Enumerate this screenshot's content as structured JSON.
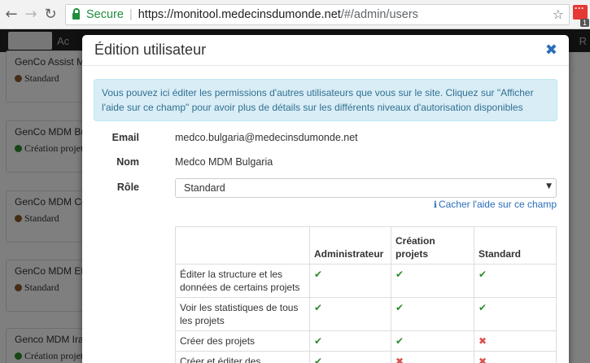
{
  "browser": {
    "secure_label": "Secure",
    "url_scheme_host": "https://monitool.medecinsdumonde.net",
    "url_path": "/#/admin/users",
    "extension_badge": "1"
  },
  "app_nav": {
    "item_partial": "Ac",
    "right_partial": "R"
  },
  "background_cards": [
    {
      "title": "GenCo Assist M",
      "role": "Standard",
      "dot": "brown"
    },
    {
      "title": "GenCo MDM Bu",
      "role": "Création projet",
      "dot": "green"
    },
    {
      "title": "GenCo MDM Co",
      "role": "Standard",
      "dot": "brown"
    },
    {
      "title": "GenCo MDM Et",
      "role": "Standard",
      "dot": "brown"
    },
    {
      "title": "Genco MDM Ira",
      "role": "Création projet",
      "dot": "green"
    }
  ],
  "modal": {
    "title": "Édition utilisateur",
    "alert": "Vous pouvez ici éditer les permissions d'autres utilisateurs que vous sur le site. Cliquez sur \"Afficher l'aide sur ce champ\" pour avoir plus de détails sur les différents niveaux d'autorisation disponibles",
    "email_label": "Email",
    "email_value": "medco.bulgaria@medecinsdumonde.net",
    "name_label": "Nom",
    "name_value": "Medco MDM Bulgaria",
    "role_label": "Rôle",
    "role_value": "Standard",
    "help_link": "Cacher l'aide sur ce champ",
    "table": {
      "headers": [
        "",
        "Administrateur",
        "Création projets",
        "Standard"
      ],
      "rows": [
        {
          "feature": "Éditer la structure et les données de certains projets",
          "admin": true,
          "creation": true,
          "standard": true
        },
        {
          "feature": "Voir les statistiques de tous les projets",
          "admin": true,
          "creation": true,
          "standard": true
        },
        {
          "feature": "Créer des projets",
          "admin": true,
          "creation": true,
          "standard": false
        },
        {
          "feature": "Créer et éditer des",
          "admin": true,
          "creation": false,
          "standard": false
        }
      ]
    }
  },
  "colors": {
    "check": "#2e8b2e",
    "cross": "#d9534f",
    "link": "#2a6ebb",
    "alert_bg": "#d9edf7"
  }
}
